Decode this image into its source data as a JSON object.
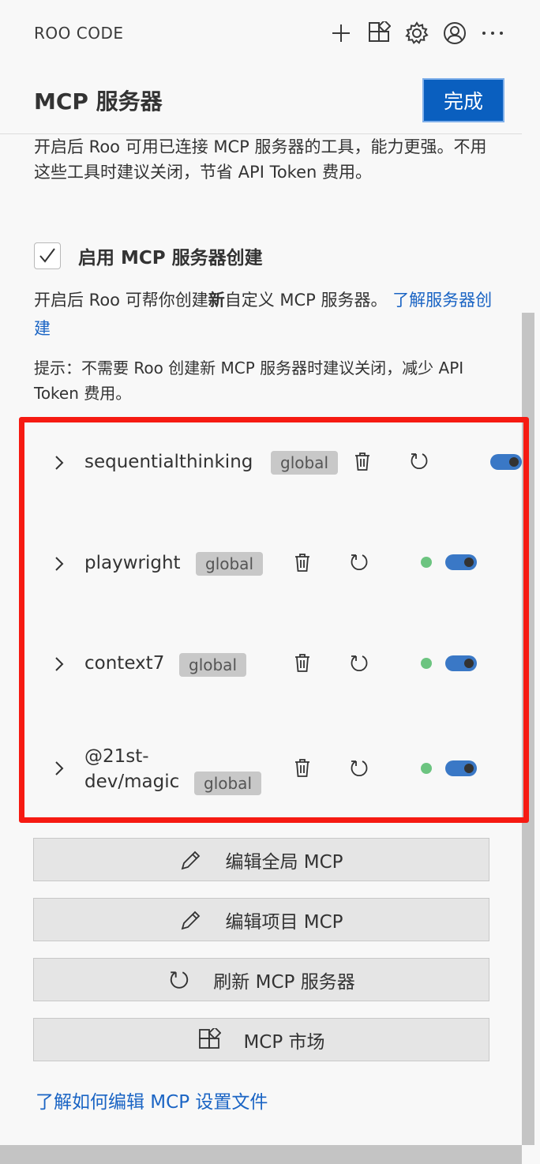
{
  "app": {
    "title": "ROO CODE"
  },
  "toolbar_icons": [
    "plus-icon",
    "marketplace-icon",
    "gear-icon",
    "account-icon",
    "more-icon"
  ],
  "header": {
    "title": "MCP 服务器",
    "done_label": "完成"
  },
  "mcp_description": "开启后 Roo 可用已连接 MCP 服务器的工具，能力更强。不用这些工具时建议关闭，节省 API Token 费用。",
  "server_creation": {
    "checked": true,
    "label": "启用 MCP 服务器创建",
    "description_prefix": "开启后 Roo 可帮你创建",
    "description_bold": "新",
    "description_suffix": "自定义 MCP 服务器。",
    "learn_link": "了解服务器创建"
  },
  "tip": "提示：不需要 Roo 创建新 MCP 服务器时建议关闭，减少 API Token 费用。",
  "servers": [
    {
      "name": "sequentialthinking",
      "scope": "global",
      "status_color": "",
      "enabled": true
    },
    {
      "name": "playwright",
      "scope": "global",
      "status_color": "#6cc480",
      "enabled": true
    },
    {
      "name": "context7",
      "scope": "global",
      "status_color": "#6cc480",
      "enabled": true
    },
    {
      "name_line1": "@21st-",
      "name_line2": "dev/magic",
      "scope": "global",
      "status_color": "#6cc480",
      "enabled": true
    }
  ],
  "actions": {
    "edit_global": "编辑全局 MCP",
    "edit_project": "编辑项目 MCP",
    "refresh": "刷新 MCP 服务器",
    "marketplace": "MCP 市场"
  },
  "footer_link": "了解如何编辑 MCP 设置文件",
  "colors": {
    "accent": "#0a5fbf",
    "link": "#1a64c4",
    "highlight": "#f61a12",
    "toggle_on": "#3a78c6",
    "status_ok": "#6cc480"
  }
}
